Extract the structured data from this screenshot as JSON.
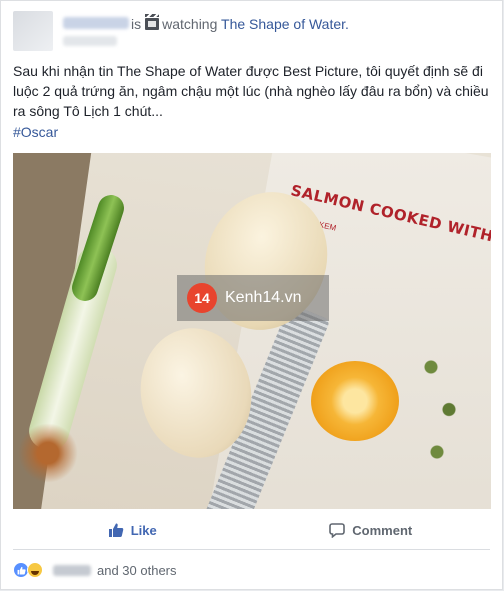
{
  "post": {
    "activity_prefix": "is",
    "activity_icon": "film-icon",
    "activity_verb": "watching",
    "activity_target": "The Shape of Water.",
    "body": "Sau khi nhận tin The Shape of Water được Best Picture, tôi quyết định sẽ đi luộc 2 quả trứng ăn, ngâm chậu một lúc (nhà nghèo lấy đâu ra bổn) và chiều ra sông Tô Lịch 1 chút...",
    "hashtag": "#Oscar",
    "photo": {
      "book_title": "SALMON COOKED WITH CREAM",
      "book_subtitle": "U KEM",
      "watermark_logo": "14",
      "watermark_text": "Kenh14.vn"
    }
  },
  "actions": {
    "like_label": "Like",
    "comment_label": "Comment"
  },
  "reactions": {
    "types": [
      "like-icon",
      "haha-icon"
    ],
    "summary": "and 30 others"
  },
  "colors": {
    "link": "#365899",
    "like_blue": "#4267b2",
    "muted": "#606770"
  }
}
